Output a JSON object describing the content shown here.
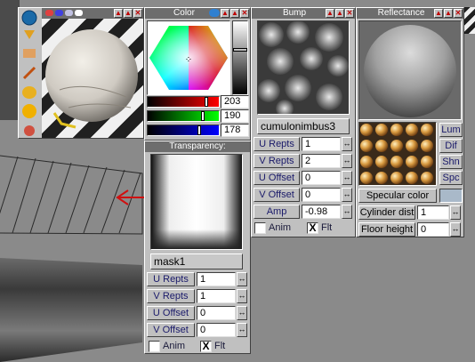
{
  "viewport": {
    "arrow_color": "#d01010"
  },
  "material_panel": {
    "tools": [
      "globe-icon",
      "cone-icon",
      "paint-brush-icon",
      "eyedropper-icon",
      "cylinder-icon",
      "sphere-icon",
      "striped-sphere-icon"
    ]
  },
  "color_panel": {
    "title": "Color",
    "rgb": [
      {
        "value": "203",
        "color": "#cc0000"
      },
      {
        "value": "190",
        "color": "#00aa00"
      },
      {
        "value": "178",
        "color": "#0000cc"
      }
    ],
    "transparency_title": "Transparency:",
    "mask_name": "mask1",
    "fields": [
      {
        "label": "U Repts",
        "value": "1"
      },
      {
        "label": "V Repts",
        "value": "1"
      },
      {
        "label": "U Offset",
        "value": "0"
      },
      {
        "label": "V Offset",
        "value": "0"
      }
    ],
    "anim_label": "Anim",
    "flt_label": "Flt",
    "flt_check": "X"
  },
  "bump_panel": {
    "title": "Bump",
    "texture_name": "cumulonimbus3",
    "fields": [
      {
        "label": "U Repts",
        "value": "1"
      },
      {
        "label": "V Repts",
        "value": "2"
      },
      {
        "label": "U Offset",
        "value": "0"
      },
      {
        "label": "V Offset",
        "value": "0"
      },
      {
        "label": "Amp",
        "value": "-0.98"
      }
    ],
    "anim_label": "Anim",
    "flt_label": "Flt",
    "flt_check": "X"
  },
  "reflectance_panel": {
    "title": "Reflectance",
    "side_buttons": [
      "Lum",
      "Dif",
      "Shn",
      "Spc"
    ],
    "specular_label": "Specular color",
    "specular_color": "#a9b9c9",
    "cylinder_label": "Cylinder dist",
    "cylinder_value": "1",
    "floor_label": "Floor height",
    "floor_value": "0"
  }
}
